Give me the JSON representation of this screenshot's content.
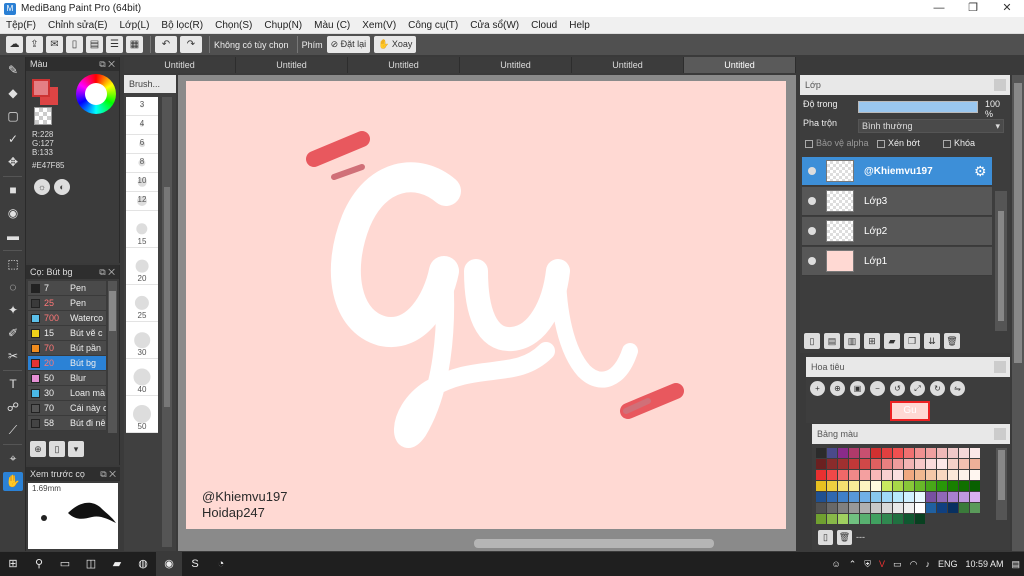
{
  "window": {
    "title": "MediBang Paint Pro (64bit)",
    "minimize": "—",
    "maximize": "❐",
    "close": "✕"
  },
  "menu": [
    "Tệp(F)",
    "Chỉnh sửa(E)",
    "Lớp(L)",
    "Bộ lọc(R)",
    "Chọn(S)",
    "Chụp(N)",
    "Màu (C)",
    "Xem(V)",
    "Công cụ(T)",
    "Cửa sổ(W)",
    "Cloud",
    "Help"
  ],
  "toolbar": {
    "no_selection": "Không có tùy chọn",
    "shortcut": "Phím",
    "reset": "Đặt lại",
    "rotate": "Xoay"
  },
  "tabs": [
    "Untitled",
    "Untitled",
    "Untitled",
    "Untitled",
    "Untitled",
    "Untitled"
  ],
  "color_panel": {
    "title": "Màu",
    "r": "R:228",
    "g": "G:127",
    "b": "B:133",
    "hex": "#E47F85"
  },
  "brush_panel": {
    "title": "Cọ: Bút bg",
    "items": [
      {
        "size": "7",
        "name": "Pen",
        "color": "#222222"
      },
      {
        "size": "25",
        "name": "Pen",
        "color": "#3a3a3a"
      },
      {
        "size": "700",
        "name": "Waterco",
        "color": "#5bc0ea"
      },
      {
        "size": "15",
        "name": "Bút vẽ c",
        "color": "#f0d21a"
      },
      {
        "size": "70",
        "name": "Bút pần",
        "color": "#f08c1e"
      },
      {
        "size": "20",
        "name": "Bút bg",
        "color": "#e33333"
      },
      {
        "size": "50",
        "name": "Blur",
        "color": "#e690d6"
      },
      {
        "size": "30",
        "name": "Loan mà",
        "color": "#4ab8e6"
      },
      {
        "size": "70",
        "name": "Cái này c",
        "color": "#555555"
      },
      {
        "size": "58",
        "name": "Bút đi nê",
        "color": "#444444"
      }
    ]
  },
  "preview_panel": {
    "title": "Xem trước cọ",
    "size": "1.69mm"
  },
  "brush_sizes": {
    "title": "Brush...",
    "items": [
      "3",
      "4",
      "6",
      "8",
      "10",
      "12",
      "15",
      "20",
      "25",
      "30",
      "40",
      "50"
    ]
  },
  "canvas": {
    "signature": "@Khiemvu197",
    "watermark": "Hoidap247",
    "art_text": "Gu",
    "background": "#FFD9D3",
    "accent": "#E8585E"
  },
  "layer_panel": {
    "title": "Lớp",
    "opacity_label": "Độ trong",
    "opacity_value": "100 %",
    "blend_label": "Pha trộn",
    "blend_value": "Bình thường",
    "protect_alpha": "Bảo vệ alpha",
    "clip": "Xén bớt",
    "lock": "Khóa",
    "layers": [
      {
        "name": "@Khiemvu197",
        "selected": true
      },
      {
        "name": "Lớp3",
        "selected": false
      },
      {
        "name": "Lớp2",
        "selected": false
      },
      {
        "name": "Lớp1",
        "selected": false
      }
    ]
  },
  "navigator": {
    "title": "Hoa tiêu",
    "thumb_text": "Gu"
  },
  "palette": {
    "title": "Bảng màu",
    "footer": "---",
    "colors": [
      "#2b2b2b",
      "#4a4a8a",
      "#8a2b8a",
      "#b03a6a",
      "#c85070",
      "#d03030",
      "#e04040",
      "#f05050",
      "#f07070",
      "#f09090",
      "#f0a0a0",
      "#f0b8b8",
      "#f0c8c8",
      "#f4d8d8",
      "#fbe8e8",
      "#6b2020",
      "#8a2b2b",
      "#a03030",
      "#c03838",
      "#d04848",
      "#e06060",
      "#e88080",
      "#f09c9c",
      "#f4b4b4",
      "#f8c8c8",
      "#fbdcdc",
      "#fde8e8",
      "#f6d2c8",
      "#f2c0b0",
      "#eeb098",
      "#e83030",
      "#f04848",
      "#f06868",
      "#f08888",
      "#f4a0a0",
      "#f8b8b8",
      "#f8d0d0",
      "#fbe0e0",
      "#f0a880",
      "#f0b890",
      "#f4c8a8",
      "#f8d8c0",
      "#fbe8d8",
      "#fdf2ea",
      "#fff6f0",
      "#e8c020",
      "#f0d040",
      "#f4e070",
      "#f8ec98",
      "#fcf4c0",
      "#fffbe0",
      "#c8e860",
      "#a8d848",
      "#88c838",
      "#68b828",
      "#48a818",
      "#289808",
      "#188000",
      "#107000",
      "#086000",
      "#205090",
      "#3068b0",
      "#4080c8",
      "#5898d8",
      "#70b0e8",
      "#88c8f0",
      "#a0d8f8",
      "#b8e8fc",
      "#d0f0ff",
      "#e8f8ff",
      "#7850a0",
      "#9068b8",
      "#a880d0",
      "#c098e0",
      "#d8b0f0",
      "#505050",
      "#686868",
      "#808080",
      "#989898",
      "#b0b0b0",
      "#c8c8c8",
      "#d8d8d8",
      "#e8e8e8",
      "#f0f0f0",
      "#ffffff",
      "#2060a0",
      "#104080",
      "#083060",
      "#3a7a3a",
      "#5a9a5a",
      "#70a030",
      "#88b848",
      "#a0d060",
      "#70c080",
      "#58b070",
      "#40a060",
      "#308850",
      "#207040",
      "#105830",
      "#084020"
    ]
  },
  "taskbar": {
    "lang": "ENG",
    "time": "10:59 AM"
  }
}
